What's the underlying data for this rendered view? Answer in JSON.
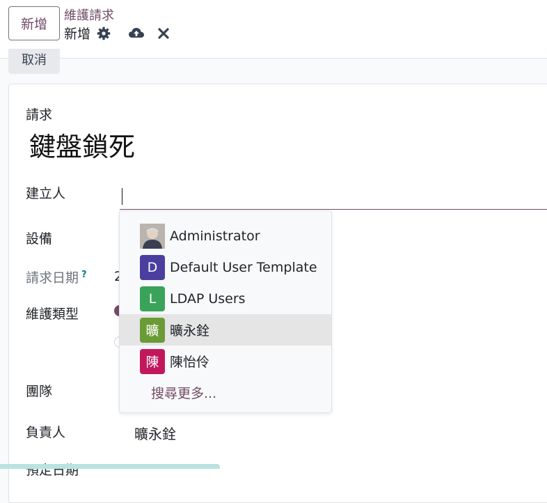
{
  "header": {
    "new_button": "新增",
    "breadcrumb_parent": "維護請求",
    "record_name": "新增"
  },
  "discard_button": "取消",
  "form": {
    "request_label": "請求",
    "request_title": "鍵盤鎖死",
    "created_by_label": "建立人",
    "equipment_label": "設備",
    "request_date_label": "請求日期",
    "help_mark": "?",
    "request_date_partial": "2",
    "maintenance_type_label": "維護類型",
    "team_label": "團隊",
    "responsible_label": "負責人",
    "responsible_value": "曠永銓",
    "next_label_partial": "預定日期"
  },
  "dropdown": {
    "items": [
      {
        "label": "Administrator",
        "avatar_letter": "",
        "avatar_color": "#8a7d74",
        "active": false
      },
      {
        "label": "Default User Template",
        "avatar_letter": "D",
        "avatar_color": "#4a3f9e",
        "active": false
      },
      {
        "label": "LDAP Users",
        "avatar_letter": "L",
        "avatar_color": "#3aa35a",
        "active": false
      },
      {
        "label": "曠永銓",
        "avatar_letter": "曠",
        "avatar_color": "#6b9b37",
        "active": true
      },
      {
        "label": "陳怡伶",
        "avatar_letter": "陳",
        "avatar_color": "#c2185b",
        "active": false
      }
    ],
    "search_more": "搜尋更多..."
  },
  "colors": {
    "brand": "#714b67",
    "help": "#017e84"
  }
}
